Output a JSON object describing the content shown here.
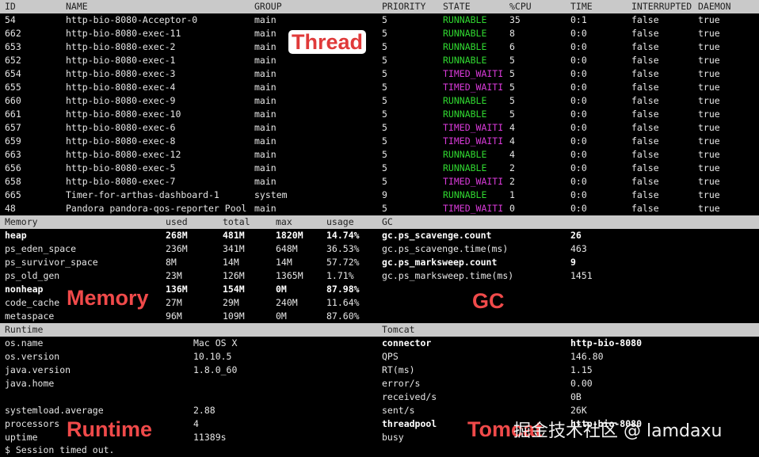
{
  "thread": {
    "headers": {
      "id": "ID",
      "name": "NAME",
      "group": "GROUP",
      "priority": "PRIORITY",
      "state": "STATE",
      "cpu": "%CPU",
      "time": "TIME",
      "interrupted": "INTERRUPTED",
      "daemon": "DAEMON"
    },
    "rows": [
      {
        "id": "54",
        "name": "http-bio-8080-Acceptor-0",
        "group": "main",
        "priority": "5",
        "state": "RUNNABLE",
        "cpu": "35",
        "time": "0:1",
        "interrupted": "false",
        "daemon": "true"
      },
      {
        "id": "662",
        "name": "http-bio-8080-exec-11",
        "group": "main",
        "priority": "5",
        "state": "RUNNABLE",
        "cpu": "8",
        "time": "0:0",
        "interrupted": "false",
        "daemon": "true"
      },
      {
        "id": "653",
        "name": "http-bio-8080-exec-2",
        "group": "main",
        "priority": "5",
        "state": "RUNNABLE",
        "cpu": "6",
        "time": "0:0",
        "interrupted": "false",
        "daemon": "true"
      },
      {
        "id": "652",
        "name": "http-bio-8080-exec-1",
        "group": "main",
        "priority": "5",
        "state": "RUNNABLE",
        "cpu": "5",
        "time": "0:0",
        "interrupted": "false",
        "daemon": "true"
      },
      {
        "id": "654",
        "name": "http-bio-8080-exec-3",
        "group": "main",
        "priority": "5",
        "state": "TIMED_WAITI",
        "cpu": "5",
        "time": "0:0",
        "interrupted": "false",
        "daemon": "true"
      },
      {
        "id": "655",
        "name": "http-bio-8080-exec-4",
        "group": "main",
        "priority": "5",
        "state": "TIMED_WAITI",
        "cpu": "5",
        "time": "0:0",
        "interrupted": "false",
        "daemon": "true"
      },
      {
        "id": "660",
        "name": "http-bio-8080-exec-9",
        "group": "main",
        "priority": "5",
        "state": "RUNNABLE",
        "cpu": "5",
        "time": "0:0",
        "interrupted": "false",
        "daemon": "true"
      },
      {
        "id": "661",
        "name": "http-bio-8080-exec-10",
        "group": "main",
        "priority": "5",
        "state": "RUNNABLE",
        "cpu": "5",
        "time": "0:0",
        "interrupted": "false",
        "daemon": "true"
      },
      {
        "id": "657",
        "name": "http-bio-8080-exec-6",
        "group": "main",
        "priority": "5",
        "state": "TIMED_WAITI",
        "cpu": "4",
        "time": "0:0",
        "interrupted": "false",
        "daemon": "true"
      },
      {
        "id": "659",
        "name": "http-bio-8080-exec-8",
        "group": "main",
        "priority": "5",
        "state": "TIMED_WAITI",
        "cpu": "4",
        "time": "0:0",
        "interrupted": "false",
        "daemon": "true"
      },
      {
        "id": "663",
        "name": "http-bio-8080-exec-12",
        "group": "main",
        "priority": "5",
        "state": "RUNNABLE",
        "cpu": "4",
        "time": "0:0",
        "interrupted": "false",
        "daemon": "true"
      },
      {
        "id": "656",
        "name": "http-bio-8080-exec-5",
        "group": "main",
        "priority": "5",
        "state": "RUNNABLE",
        "cpu": "2",
        "time": "0:0",
        "interrupted": "false",
        "daemon": "true"
      },
      {
        "id": "658",
        "name": "http-bio-8080-exec-7",
        "group": "main",
        "priority": "5",
        "state": "TIMED_WAITI",
        "cpu": "2",
        "time": "0:0",
        "interrupted": "false",
        "daemon": "true"
      },
      {
        "id": "665",
        "name": "Timer-for-arthas-dashboard-1",
        "group": "system",
        "priority": "9",
        "state": "RUNNABLE",
        "cpu": "1",
        "time": "0:0",
        "interrupted": "false",
        "daemon": "true"
      },
      {
        "id": "48",
        "name": "Pandora pandora-qos-reporter Pool",
        "group": "main",
        "priority": "5",
        "state": "TIMED_WAITI",
        "cpu": "0",
        "time": "0:0",
        "interrupted": "false",
        "daemon": "true"
      }
    ]
  },
  "memory": {
    "headers": {
      "name": "Memory",
      "used": "used",
      "total": "total",
      "max": "max",
      "usage": "usage"
    },
    "rows": [
      {
        "name": "heap",
        "used": "268M",
        "total": "481M",
        "max": "1820M",
        "usage": "14.74%",
        "bold": true
      },
      {
        "name": "ps_eden_space",
        "used": "236M",
        "total": "341M",
        "max": "648M",
        "usage": "36.53%",
        "bold": false
      },
      {
        "name": "ps_survivor_space",
        "used": "8M",
        "total": "14M",
        "max": "14M",
        "usage": "57.72%",
        "bold": false
      },
      {
        "name": "ps_old_gen",
        "used": "23M",
        "total": "126M",
        "max": "1365M",
        "usage": "1.71%",
        "bold": false
      },
      {
        "name": "nonheap",
        "used": "136M",
        "total": "154M",
        "max": "0M",
        "usage": "87.98%",
        "bold": true
      },
      {
        "name": "code_cache",
        "used": "27M",
        "total": "29M",
        "max": "240M",
        "usage": "11.64%",
        "bold": false
      },
      {
        "name": "metaspace",
        "used": "96M",
        "total": "109M",
        "max": "0M",
        "usage": "87.60%",
        "bold": false
      }
    ]
  },
  "gc": {
    "header": "GC",
    "rows": [
      {
        "name": "gc.ps_scavenge.count",
        "value": "26",
        "bold": true
      },
      {
        "name": "gc.ps_scavenge.time(ms)",
        "value": "463",
        "bold": false
      },
      {
        "name": "gc.ps_marksweep.count",
        "value": "9",
        "bold": true
      },
      {
        "name": "gc.ps_marksweep.time(ms)",
        "value": "1451",
        "bold": false
      }
    ]
  },
  "runtime": {
    "header": "Runtime",
    "rows": [
      {
        "name": "os.name",
        "value": "Mac OS X"
      },
      {
        "name": "os.version",
        "value": "10.10.5"
      },
      {
        "name": "java.version",
        "value": "1.8.0_60"
      },
      {
        "name": "java.home",
        "value": ""
      },
      {
        "name": "",
        "value": ""
      },
      {
        "name": "systemload.average",
        "value": "2.88"
      },
      {
        "name": "processors",
        "value": "4"
      },
      {
        "name": "uptime",
        "value": "11389s"
      }
    ]
  },
  "tomcat": {
    "header": "Tomcat",
    "rows": [
      {
        "name": "connector",
        "value": "http-bio-8080",
        "bold": true
      },
      {
        "name": "QPS",
        "value": "146.80",
        "bold": false
      },
      {
        "name": "RT(ms)",
        "value": "1.15",
        "bold": false
      },
      {
        "name": "error/s",
        "value": "0.00",
        "bold": false
      },
      {
        "name": "received/s",
        "value": "0B",
        "bold": false
      },
      {
        "name": "sent/s",
        "value": "26K",
        "bold": false
      },
      {
        "name": "threadpool",
        "value": "http-bio-8080",
        "bold": true
      },
      {
        "name": "busy",
        "value": "",
        "bold": false
      }
    ]
  },
  "overlays": {
    "thread": "Thread",
    "memory": "Memory",
    "gc": "GC",
    "runtime": "Runtime",
    "tomcat": "Tomcat"
  },
  "watermark": "掘金技术社区 @ lamdaxu",
  "prompt": "$ Session timed out.",
  "colors": {
    "runnable": "#30d830",
    "timed_waiting": "#d93ad9",
    "header_bg": "#c9c9c9",
    "annotation": "#f04a4a"
  }
}
